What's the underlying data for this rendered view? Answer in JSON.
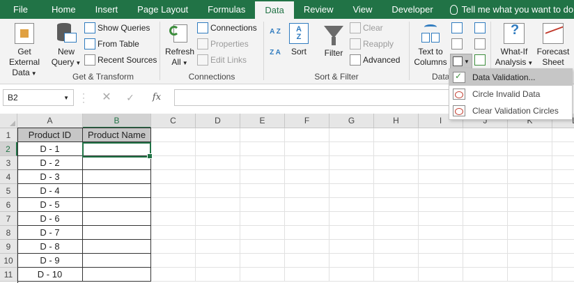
{
  "menu_tabs": [
    "File",
    "Home",
    "Insert",
    "Page Layout",
    "Formulas",
    "Data",
    "Review",
    "View",
    "Developer"
  ],
  "active_tab": "Data",
  "tell_me": "Tell me what you want to do...",
  "ribbon": {
    "get_transform": {
      "label": "Get & Transform",
      "get_external_line1": "Get External",
      "get_external_line2": "Data",
      "new_query_line1": "New",
      "new_query_line2": "Query",
      "show_queries": "Show Queries",
      "from_table": "From Table",
      "recent_sources": "Recent Sources"
    },
    "connections": {
      "label": "Connections",
      "refresh_line1": "Refresh",
      "refresh_line2": "All",
      "connections": "Connections",
      "properties": "Properties",
      "edit_links": "Edit Links"
    },
    "sort_filter": {
      "label": "Sort & Filter",
      "sort_az": "A Z",
      "sort_za": "Z A",
      "sort": "Sort",
      "filter": "Filter",
      "clear": "Clear",
      "reapply": "Reapply",
      "advanced": "Advanced"
    },
    "data_tools": {
      "label": "Data",
      "text_to_columns_line1": "Text to",
      "text_to_columns_line2": "Columns"
    },
    "forecast": {
      "whatif_line1": "What-If",
      "whatif_line2": "Analysis",
      "forecast_line1": "Forecast",
      "forecast_line2": "Sheet"
    }
  },
  "dropdown": {
    "items": [
      "Data Validation...",
      "Circle Invalid Data",
      "Clear Validation Circles"
    ]
  },
  "formula_bar": {
    "name_box": "B2",
    "fx": "fx",
    "value": ""
  },
  "columns": [
    "A",
    "B",
    "C",
    "D",
    "E",
    "F",
    "G",
    "H",
    "I",
    "J",
    "K",
    "L"
  ],
  "rows": [
    "1",
    "2",
    "3",
    "4",
    "5",
    "6",
    "7",
    "8",
    "9",
    "10",
    "11"
  ],
  "table": {
    "headers": [
      "Product ID",
      "Product Name"
    ],
    "product_ids": [
      "D - 1",
      "D - 2",
      "D - 3",
      "D - 4",
      "D - 5",
      "D - 6",
      "D - 7",
      "D - 8",
      "D - 9",
      "D - 10"
    ]
  },
  "colors": {
    "excel_green": "#217346",
    "ribbon_bg": "#f3f3f3",
    "table_header_bg": "#c6c6c6"
  }
}
